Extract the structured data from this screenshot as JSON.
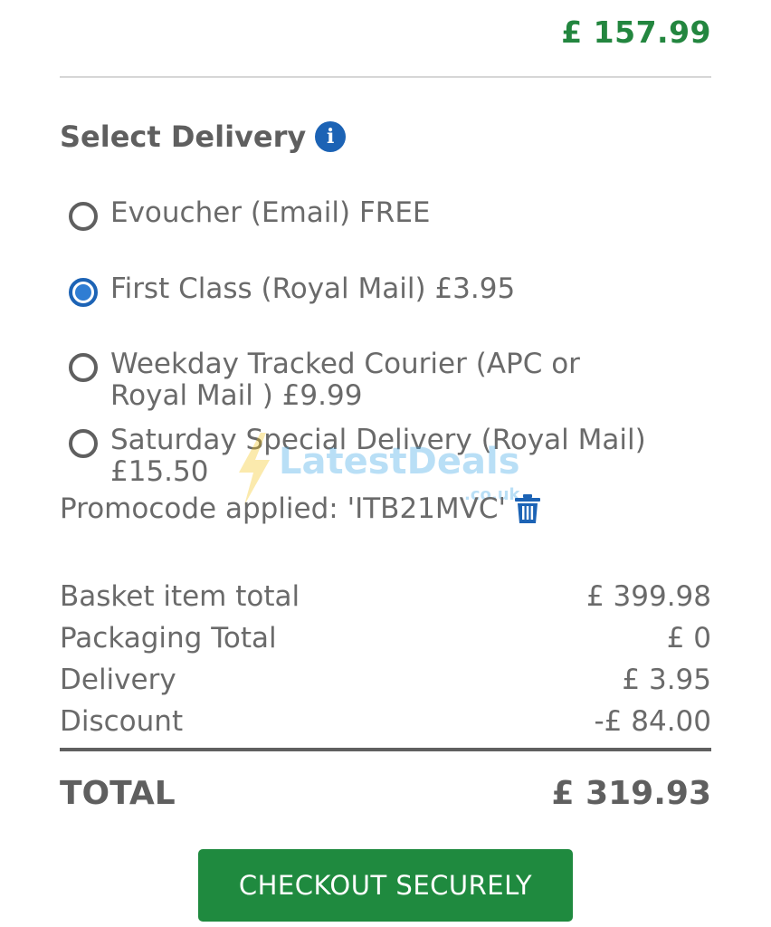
{
  "header": {
    "price": "£ 157.99"
  },
  "delivery": {
    "title": "Select Delivery",
    "info_icon": "info-icon",
    "options": [
      {
        "label": "Evoucher (Email) FREE",
        "selected": false
      },
      {
        "label": "First Class (Royal Mail) £3.95",
        "selected": true
      },
      {
        "label": "Weekday Tracked Courier (APC or Royal Mail ) £9.99",
        "selected": false
      },
      {
        "label": "Saturday Special Delivery (Royal Mail) £15.50",
        "selected": false
      }
    ]
  },
  "promo": {
    "text": "Promocode applied: 'ITB21MVC'",
    "remove_icon": "trash-icon"
  },
  "summary": {
    "rows": [
      {
        "label": "Basket item total",
        "value": "£ 399.98"
      },
      {
        "label": "Packaging Total",
        "value": "£ 0"
      },
      {
        "label": "Delivery",
        "value": "£ 3.95"
      },
      {
        "label": "Discount",
        "value": "-£ 84.00"
      }
    ],
    "total_label": "TOTAL",
    "total_value": "£ 319.93"
  },
  "checkout": {
    "label": "CHECKOUT SECURELY"
  },
  "watermark": {
    "text": "LatestDeals",
    "sub": ".co.uk"
  },
  "colors": {
    "price_green": "#23863f",
    "button_green": "#1f8a3f",
    "accent_blue": "#1c63b5",
    "text_grey": "#6a6a6a"
  }
}
